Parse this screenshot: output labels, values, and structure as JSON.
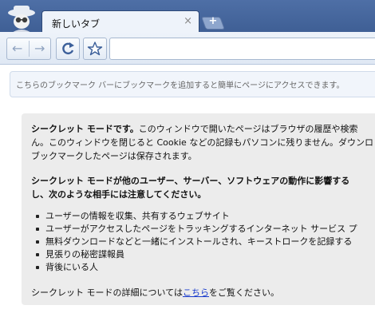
{
  "tab": {
    "title": "新しいタブ",
    "close_symbol": "×"
  },
  "new_tab": {
    "symbol": "+"
  },
  "bookmark_bar": {
    "message": "こちらのブックマーク バーにブックマークを追加すると簡単にページにアクセスできます。"
  },
  "incognito": {
    "para1": [
      "シークレット モードです。このウィンドウで開いたページはブラウザの履歴や検索",
      "ん。このウィンドウを閉じると Cookie などの記録もパソコンに残りません。ダウンロ",
      "ブックマークしたページは保存されます。"
    ],
    "para2": [
      "シークレット モードが他のユーザー、サーバー、ソフトウェアの動作に影響する",
      "し、次のような相手には注意してください。"
    ],
    "bullets": [
      "ユーザーの情報を収集、共有するウェブサイト",
      "ユーザーがアクセスしたページをトラッキングするインターネット サービス プ",
      "無料ダウンロードなどと一緒にインストールされ、キーストロークを記録する",
      "見張りの秘密諜報員",
      "背後にいる人"
    ],
    "footer_before": "シークレット モードの詳細については",
    "footer_link": "こちら",
    "footer_after": "をご覧ください。"
  },
  "colors": {
    "titlebar": "#4e6fa6",
    "link": "#1a3ccc"
  }
}
